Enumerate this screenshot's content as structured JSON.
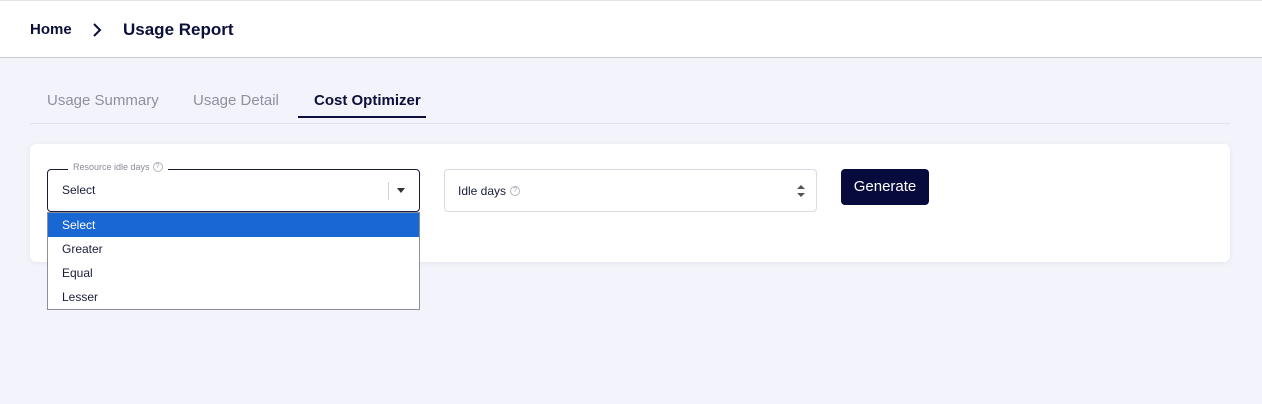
{
  "breadcrumb": {
    "home": "Home",
    "current": "Usage Report"
  },
  "tabs": [
    {
      "label": "Usage Summary",
      "active": false
    },
    {
      "label": "Usage Detail",
      "active": false
    },
    {
      "label": "Cost Optimizer",
      "active": true
    }
  ],
  "form": {
    "resource_idle_days": {
      "label": "Resource idle days",
      "help_icon": "question-circle-icon",
      "value": "Select",
      "options": [
        "Select",
        "Greater",
        "Equal",
        "Lesser"
      ],
      "highlighted_option": "Select"
    },
    "idle_days": {
      "label": "Idle days",
      "help_icon": "question-circle-icon",
      "value": ""
    },
    "generate_label": "Generate"
  },
  "colors": {
    "primary": "#070a3d",
    "highlight": "#1967d2",
    "background": "#f3f4fb"
  }
}
